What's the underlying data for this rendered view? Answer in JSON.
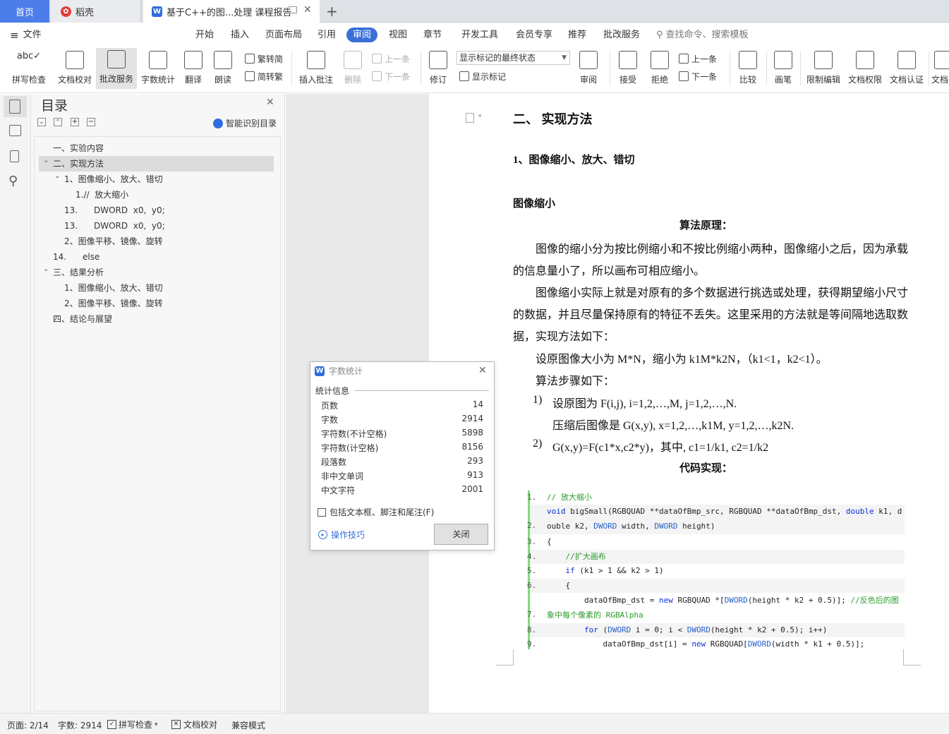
{
  "tabs": {
    "home": "首页",
    "daoke": "稻壳",
    "doc": "基于C++的图...处理 课程报告",
    "add": "+"
  },
  "menu": {
    "file": "文件",
    "items": [
      "开始",
      "插入",
      "页面布局",
      "引用",
      "审阅",
      "视图",
      "章节",
      "开发工具",
      "会员专享",
      "推荐",
      "批改服务"
    ],
    "active": "审阅",
    "search_placeholder": "查找命令、搜索模板"
  },
  "ribbon": {
    "spell": "拼写检查",
    "proofread": "文档校对",
    "correction": "批改服务",
    "wordcount": "字数统计",
    "translate": "翻译",
    "read": "朗读",
    "trad_to_simp": "繁转简",
    "simp_to_trad": "简转繁",
    "insert_comment": "插入批注",
    "delete": "删除",
    "prev1": "上一条",
    "next1": "下一条",
    "revise": "修订",
    "show_state": "显示标记的最终状态",
    "show_marks": "显示标记",
    "review": "审阅",
    "accept": "接受",
    "reject": "拒绝",
    "prev2": "上一条",
    "next2": "下一条",
    "compare": "比较",
    "pen": "画笔",
    "restrict_edit": "限制编辑",
    "doc_rights": "文档权限",
    "doc_cert": "文档认证",
    "doc_more": "文档"
  },
  "nav": {
    "title": "目录",
    "smart": "智能识别目录",
    "items": [
      "一、实验内容",
      "二、实现方法",
      "1、图像缩小、放大、错切",
      "1.//  放大缩小",
      "13.      DWORD  x0,  y0;",
      "13.      DWORD  x0,  y0;",
      "2、图像平移、镜像、旋转",
      "14.      else",
      "三、结果分析",
      "1、图像缩小、放大、错切",
      "2、图像平移、镜像、旋转",
      "四、结论与展望"
    ]
  },
  "doc": {
    "h2": "二、  实现方法",
    "h3": "1、图像缩小、放大、错切",
    "h4": "图像缩小",
    "principle": "算法原理：",
    "p1a": "图像的缩小分为按比例缩小和不按比例缩小两种，图像缩小之后，因为承载",
    "p1b": "的信息量小了，所以画布可相应缩小。",
    "p2a": "图像缩小实际上就是对原有的多个数据进行挑选或处理，获得期望缩小尺寸",
    "p2b": "的数据，并且尽量保持原有的特征不丢失。这里采用的方法就是等间隔地选取数",
    "p2c": "据，实现方法如下：",
    "p3": "设原图像大小为 M*N，缩小为 k1M*k2N，（k1<1，k2<1）。",
    "p4": "算法步骤如下：",
    "s1n": "1)",
    "s1": "设原图为 F(i,j), i=1,2,…,M,    j=1,2,…,N.",
    "s1b": "压缩后图像是 G(x,y), x=1,2,…,k1M, y=1,2,…,k2N.",
    "s2n": "2)",
    "s2": "G(x,y)=F(c1*x,c2*y)，其中, c1=1/k1, c2=1/k2",
    "code_title": "代码实现："
  },
  "code": {
    "nums": [
      "1.",
      "2.",
      "3.",
      "4.",
      "5.",
      "6.",
      "7.",
      "8.",
      "9."
    ],
    "l1": "// 放大缩小",
    "l2_void": "void",
    "l2_rest": " bigSmall(RGBQUAD **dataOfBmp_src, RGBQUAD **dataOfBmp_dst, ",
    "l2_double": "double",
    "l2_k1": " k1, d",
    "l2b_a": "ouble k2, ",
    "l2b_dword": "DWORD",
    "l2b_b": " width, ",
    "l2b_dword2": "DWORD",
    "l2b_c": " height)",
    "l3": "{",
    "l4": "    //扩大画布",
    "l5_if": "    if",
    "l5_rest": " (k1 > 1 && k2 > 1)",
    "l6": "    {",
    "l7_a": "        dataOfBmp_dst = ",
    "l7_new": "new",
    "l7_b": " RGBQUAD *[",
    "l7_dword": "DWORD",
    "l7_c": "(height * k2 + 0.5)]; ",
    "l7_cm": "//反色后的图",
    "l7b_cm": "象中每个像素的 RGBAlpha",
    "l8_for": "        for",
    "l8_a": " (",
    "l8_dword": "DWORD",
    "l8_b": " i = 0; i < ",
    "l8_dword2": "DWORD",
    "l8_c": "(height * k2 + 0.5); i++)",
    "l9_a": "            dataOfBmp_dst[i] = ",
    "l9_new": "new",
    "l9_b": " RGBQUAD[",
    "l9_dword": "DWORD",
    "l9_c": "(width * k1 + 0.5)];"
  },
  "dialog": {
    "title": "字数统计",
    "section": "统计信息",
    "rows": [
      {
        "label": "页数",
        "value": "14"
      },
      {
        "label": "字数",
        "value": "2914"
      },
      {
        "label": "字符数(不计空格)",
        "value": "5898"
      },
      {
        "label": "字符数(计空格)",
        "value": "8156"
      },
      {
        "label": "段落数",
        "value": "293"
      },
      {
        "label": "非中文单词",
        "value": "913"
      },
      {
        "label": "中文字符",
        "value": "2001"
      }
    ],
    "checkbox": "包括文本框、脚注和尾注(F)",
    "tips": "操作技巧",
    "close": "关闭"
  },
  "status": {
    "page": "页面: 2/14",
    "words": "字数: 2914",
    "spell": "拼写检查",
    "proofread": "文档校对",
    "compat": "兼容模式"
  },
  "colors": {
    "accent": "#4c7de8",
    "active_tab": "#3a6fd8",
    "code_bar": "#7ddb7d"
  }
}
